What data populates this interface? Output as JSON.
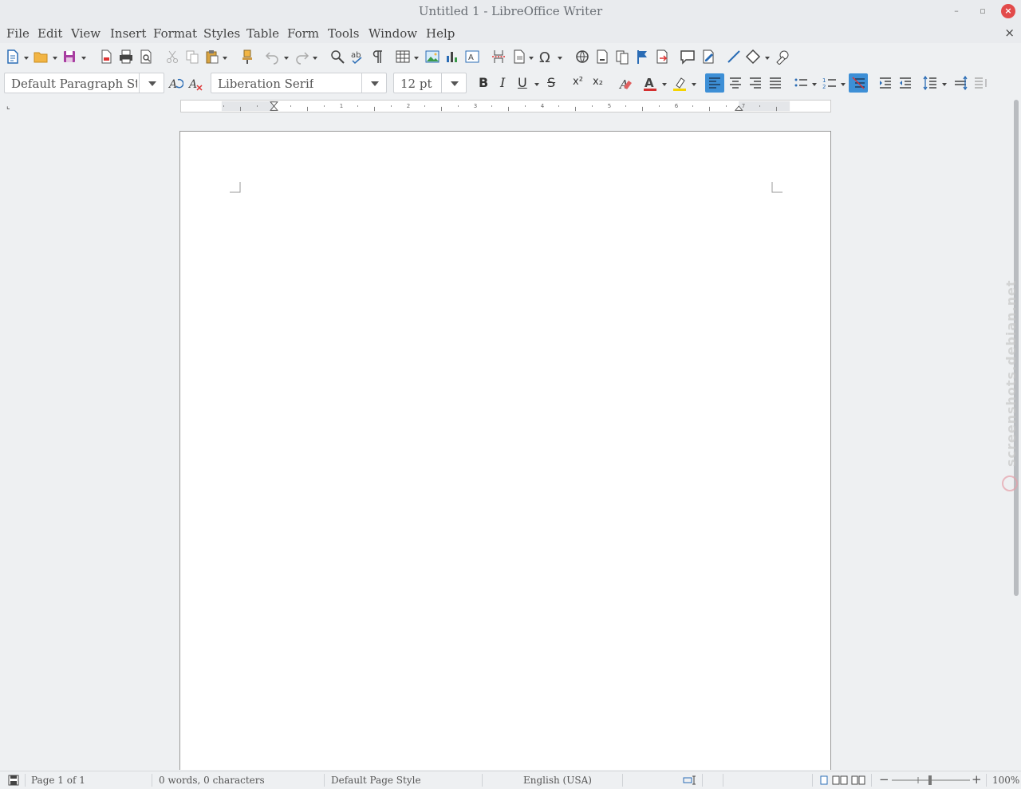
{
  "window": {
    "title": "Untitled 1 - LibreOffice Writer",
    "minimize_glyph": "–",
    "restore_glyph": "▫",
    "close_glyph": "×"
  },
  "menubar": {
    "items": [
      "File",
      "Edit",
      "View",
      "Insert",
      "Format",
      "Styles",
      "Table",
      "Form",
      "Tools",
      "Window",
      "Help"
    ],
    "close_document_glyph": "×"
  },
  "formatting": {
    "paragraph_style": "Default Paragraph Style",
    "font_name": "Liberation Serif",
    "font_size": "12 pt",
    "alignment_selected": "left",
    "bold_glyph": "B",
    "italic_glyph": "I",
    "underline_glyph": "U",
    "strike_glyph": "S",
    "superscript_glyph": "x²",
    "subscript_glyph": "x₂",
    "text_color": "#d32f2f",
    "highlight_color": "#f5d400"
  },
  "ruler": {
    "labels": [
      "1",
      "2",
      "3",
      "4",
      "5",
      "6",
      "7"
    ],
    "unit": "inches"
  },
  "statusbar": {
    "page": "Page 1 of 1",
    "words": "0 words, 0 characters",
    "page_style": "Default Page Style",
    "language": "English (USA)",
    "zoom": "100%",
    "zoom_level": 1.0
  },
  "watermark": {
    "text": "screenshots.debian.net"
  },
  "colors": {
    "accent": "#3d8fd6",
    "close_button": "#e24a4a",
    "background": "#eef0f2"
  }
}
